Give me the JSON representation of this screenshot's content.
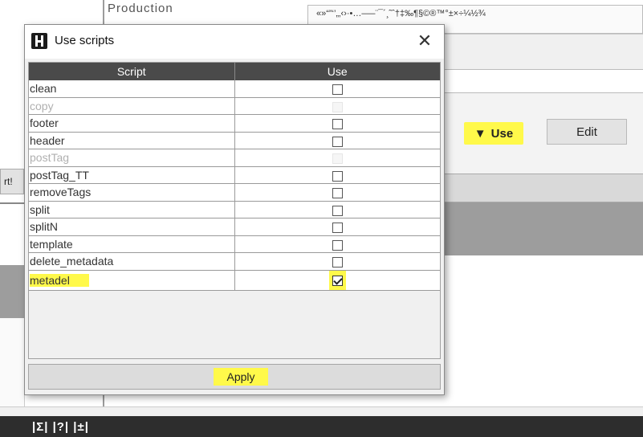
{
  "background": {
    "header_text": "Production",
    "special_chars": "«»“”‘’„‚‹›·•…–—¨¯´¸˜ˆ†‡‰¶§©®™°±×÷¼½¾",
    "use_label": "Use",
    "use_marker": "▼",
    "edit_label": "Edit",
    "left_button_label": "rt!",
    "bottom_bar_text": "|Σ| |?| |±|"
  },
  "dialog": {
    "title": "Use scripts",
    "close_glyph": "✕",
    "columns": [
      "Script",
      "Use"
    ],
    "rows": [
      {
        "name": "clean",
        "checked": false,
        "enabled": true
      },
      {
        "name": "copy",
        "checked": false,
        "enabled": false
      },
      {
        "name": "footer",
        "checked": false,
        "enabled": true
      },
      {
        "name": "header",
        "checked": false,
        "enabled": true
      },
      {
        "name": "postTag",
        "checked": false,
        "enabled": false
      },
      {
        "name": "postTag_TT",
        "checked": false,
        "enabled": true
      },
      {
        "name": "removeTags",
        "checked": false,
        "enabled": true
      },
      {
        "name": "split",
        "checked": false,
        "enabled": true
      },
      {
        "name": "splitN",
        "checked": false,
        "enabled": true
      },
      {
        "name": "template",
        "checked": false,
        "enabled": true
      },
      {
        "name": "delete_metadata",
        "checked": false,
        "enabled": true
      },
      {
        "name": "metadel",
        "checked": true,
        "enabled": true,
        "highlighted": true
      }
    ],
    "apply_label": "Apply"
  },
  "colors": {
    "highlight": "#fff94a",
    "header_bg": "#4a4a4a"
  }
}
